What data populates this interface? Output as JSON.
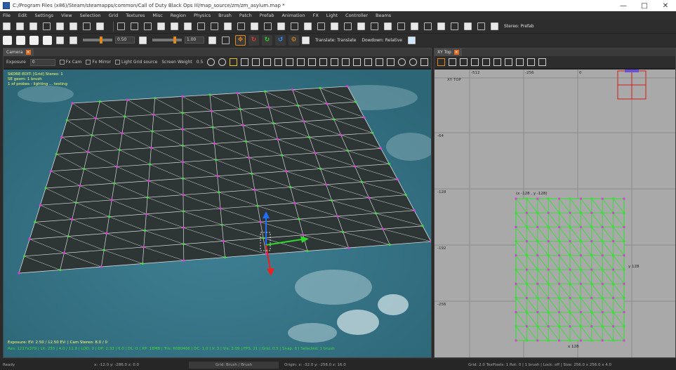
{
  "window": {
    "title": "C:/Program Files (x86)/Steam/steamapps/common/Call of Duty Black Ops III/map_source/zm/zm_asylum.map *",
    "minimize": "—",
    "maximize": "□",
    "close": "✕"
  },
  "menu": [
    "File",
    "Edit",
    "Settings",
    "View",
    "Selection",
    "Grid",
    "Textures",
    "Misc",
    "Region",
    "Physics",
    "Brush",
    "Patch",
    "Prefab",
    "Animation",
    "FX",
    "Light",
    "Controller",
    "Beams"
  ],
  "toolbar1": {
    "stereo_label": "Stereo: Prefab"
  },
  "toolbar2": {
    "speed_value": "0.50",
    "zoom_value": "1.00",
    "mode_left": "Translate: Translate",
    "mode_right": "Dowdown: Relative"
  },
  "camera_panel": {
    "tab_label": "Camera",
    "toolbar": {
      "exposure_label": "Exposure",
      "exposure_value": "0",
      "fx_cam_label": "Fx Cam",
      "fx_mirror_label": "Fx Mirror",
      "light_grid_label": "Light Grid source",
      "screen_weight_label": "Screen Weight",
      "screen_weight_value": "0.5"
    },
    "overlay_top": [
      "SKORE-EDIT: [Grid] Stereo: 1",
      "SE geom: 1 brush",
      "1 of probes - lighting ... testing"
    ],
    "overlay_bottom_1": "Exposure: EV: 2.50 / 12.50 EV: | Cam Stereo: 8.0 / 0",
    "overlay_bottom_2": "Res: 1217x379 | Lit: 255 | 4.0 / 11.8 | LOD: 0 | DP: 2.33 | 0.0 | DL: 0 | XP: 18MB | Tris: 6080466 | DC: 1.0 | V: 3 | Vis: 2.09 | FPS: 21 | Grid: 0.5 | Snap: 8 | Selected: 1 brush"
  },
  "top_panel": {
    "tab_label": "XY Top",
    "view_label": "XY TOP",
    "ruler_top": [
      "-512",
      "-256",
      "0"
    ],
    "ruler_left": [
      "-64",
      "-128",
      "-192",
      "-256"
    ],
    "patch_coords_label": "(x -128 , y -128)",
    "patch_width_label": "x 128",
    "patch_height_label": "y 128"
  },
  "status": {
    "left": "Ready",
    "middle": "x: -12.0  y: -286.0  z: 0.0",
    "center_box": "Grid: Brush / Brush",
    "right_coords": "Origin: x: -32.0  y: -256.0  z: 16.0",
    "right_info": "Grid: 2.0  TexPixels: 1  Rot: 0  | 1 brush  | Lock: off  | Size: 256.0 x 256.0 x 4.0"
  },
  "colors": {
    "accent": "#e08a1e",
    "selection_green": "#3ddc3d",
    "vertex_magenta": "#e23ae2",
    "gizmo_blue": "#1f6fff",
    "gizmo_green": "#2fd82f",
    "gizmo_red": "#ee2020"
  }
}
